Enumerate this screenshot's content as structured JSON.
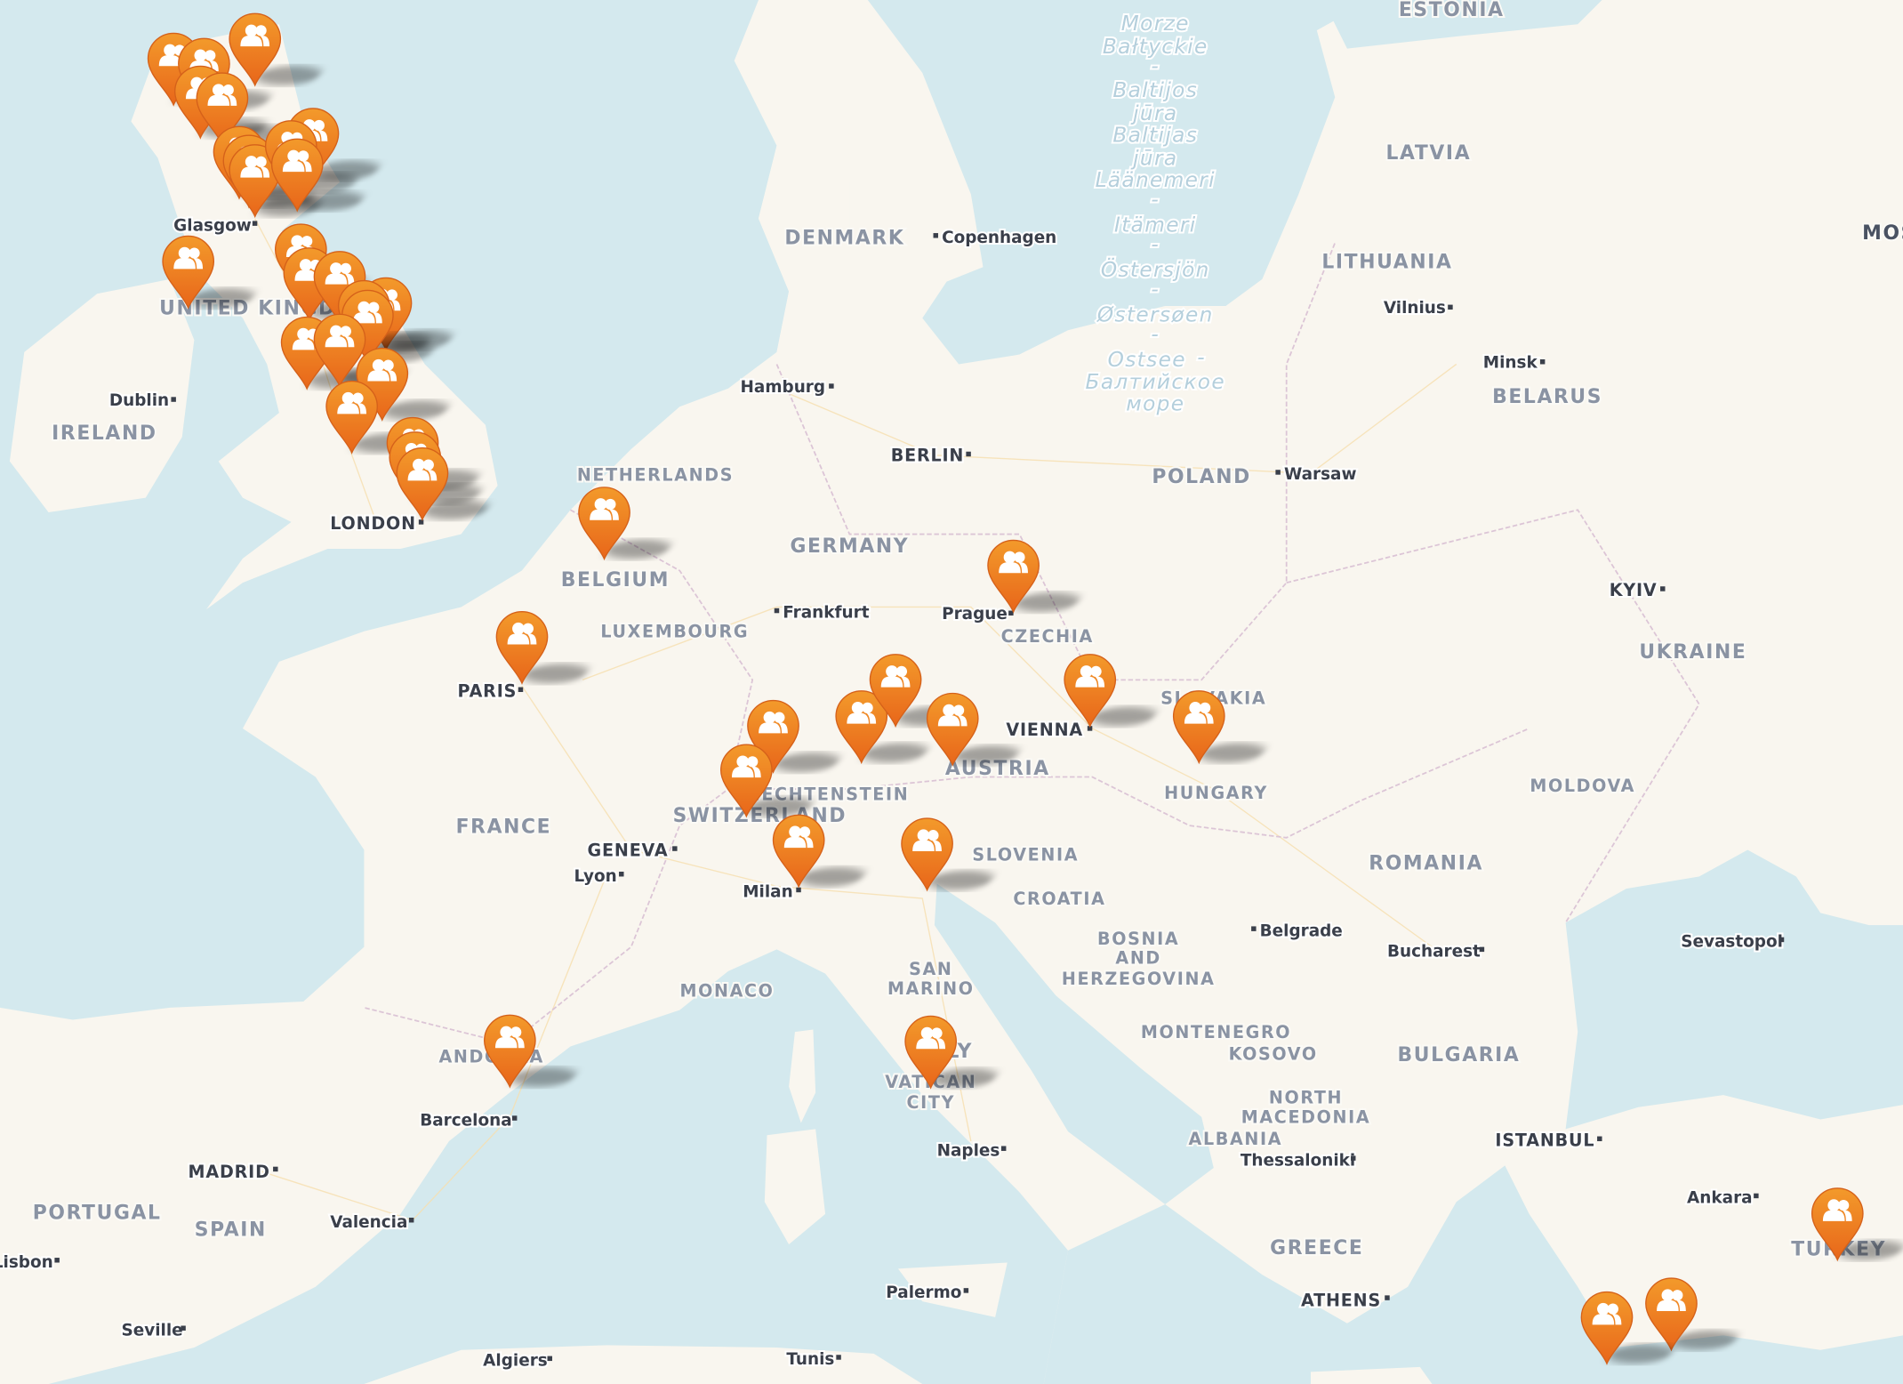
{
  "map": {
    "colors": {
      "sea": "#d4e9ee",
      "land": "#f9f6ef",
      "marker_top": "#f39a2b",
      "marker_bottom": "#e8661a",
      "marker_icon": "#ffffff"
    },
    "marker_icon": "users-icon",
    "markers": [
      {
        "lat": 57.72,
        "lon": -4.22
      },
      {
        "lat": 57.46,
        "lon": -6.23
      },
      {
        "lat": 57.39,
        "lon": -5.48
      },
      {
        "lat": 57.02,
        "lon": -5.57
      },
      {
        "lat": 56.93,
        "lon": -5.03
      },
      {
        "lat": 56.2,
        "lon": -4.61
      },
      {
        "lat": 56.08,
        "lon": -4.37
      },
      {
        "lat": 55.95,
        "lon": -4.22
      },
      {
        "lat": 56.45,
        "lon": -2.79
      },
      {
        "lat": 56.28,
        "lon": -3.33
      },
      {
        "lat": 56.03,
        "lon": -3.18
      },
      {
        "lat": 54.67,
        "lon": -5.87
      },
      {
        "lat": 54.84,
        "lon": -3.09
      },
      {
        "lat": 54.5,
        "lon": -2.88
      },
      {
        "lat": 54.45,
        "lon": -2.13
      },
      {
        "lat": 54.07,
        "lon": -0.99
      },
      {
        "lat": 54.03,
        "lon": -1.53
      },
      {
        "lat": 53.89,
        "lon": -1.44
      },
      {
        "lat": 53.5,
        "lon": -2.94
      },
      {
        "lat": 53.54,
        "lon": -2.13
      },
      {
        "lat": 53.04,
        "lon": -1.08
      },
      {
        "lat": 52.55,
        "lon": -1.83
      },
      {
        "lat": 52.0,
        "lon": -0.33
      },
      {
        "lat": 51.78,
        "lon": -0.27
      },
      {
        "lat": 51.54,
        "lon": -0.09
      },
      {
        "lat": 50.93,
        "lon": 4.4
      },
      {
        "lat": 48.96,
        "lon": 2.37
      },
      {
        "lat": 50.1,
        "lon": 14.5
      },
      {
        "lat": 47.5,
        "lon": 8.57
      },
      {
        "lat": 46.76,
        "lon": 7.91
      },
      {
        "lat": 47.66,
        "lon": 10.75
      },
      {
        "lat": 48.26,
        "lon": 11.59
      },
      {
        "lat": 47.62,
        "lon": 13.0
      },
      {
        "lat": 48.26,
        "lon": 16.39
      },
      {
        "lat": 47.66,
        "lon": 19.08
      },
      {
        "lat": 45.56,
        "lon": 9.2
      },
      {
        "lat": 45.5,
        "lon": 12.37
      },
      {
        "lat": 42.0,
        "lon": 2.07
      },
      {
        "lat": 41.98,
        "lon": 12.46
      },
      {
        "lat": 38.75,
        "lon": 34.84
      },
      {
        "lat": 37.0,
        "lon": 30.74
      },
      {
        "lat": 36.73,
        "lon": 29.15
      }
    ],
    "countries": [
      "ESTONIA",
      "LATVIA",
      "LITHUANIA",
      "BELARUS",
      "POLAND",
      "GERMANY",
      "NETHERLANDS",
      "BELGIUM",
      "LUXEMBOURG",
      "DENMARK",
      "UNITED KINGDOM",
      "IRELAND",
      "FRANCE",
      "CZECHIA",
      "SLOVAKIA",
      "AUSTRIA",
      "HUNGARY",
      "LIECHTENSTEIN",
      "SWITZERLAND",
      "SLOVENIA",
      "CROATIA",
      "BOSNIA",
      "AND",
      "HERZEGOVINA",
      "MONTENEGRO",
      "KOSOVO",
      "NORTH",
      "MACEDONIA",
      "ALBANIA",
      "ROMANIA",
      "MOLDOVA",
      "UKRAINE",
      "BULGARIA",
      "GREECE",
      "TURKEY",
      "ITALY",
      "SAN",
      "MARINO",
      "VATICAN",
      "CITY",
      "MONACO",
      "ANDORRA",
      "SPAIN",
      "PORTUGAL",
      "MOSCOW"
    ],
    "cities": [
      "Glasgow",
      "Dublin",
      "LONDON",
      "PARIS",
      "Hamburg",
      "BERLIN",
      "Copenhagen",
      "Frankfurt",
      "Prague",
      "VIENNA",
      "Warsaw",
      "Vilnius",
      "Minsk",
      "KYIV",
      "GENEVA",
      "Lyon",
      "Milan",
      "Belgrade",
      "Bucharest",
      "Sevastopol",
      "Barcelona",
      "MADRID",
      "Valencia",
      "Lisbon",
      "Seville",
      "Naples",
      "Palermo",
      "ISTANBUL",
      "Thessaloniki",
      "Ankara",
      "ATHENS",
      "Algiers",
      "Tunis"
    ],
    "sea_labels": [
      "Morze",
      "Bałtyckie",
      "-",
      "Baltijos",
      "jūra",
      "-",
      "Baltijas",
      "jūra",
      "-",
      "Läänemeri",
      "-",
      "Itämeri",
      "-",
      "Östersjön",
      "-",
      "Østersøen",
      "-",
      "Ostsee",
      "-",
      "Балтийское",
      "море"
    ]
  }
}
